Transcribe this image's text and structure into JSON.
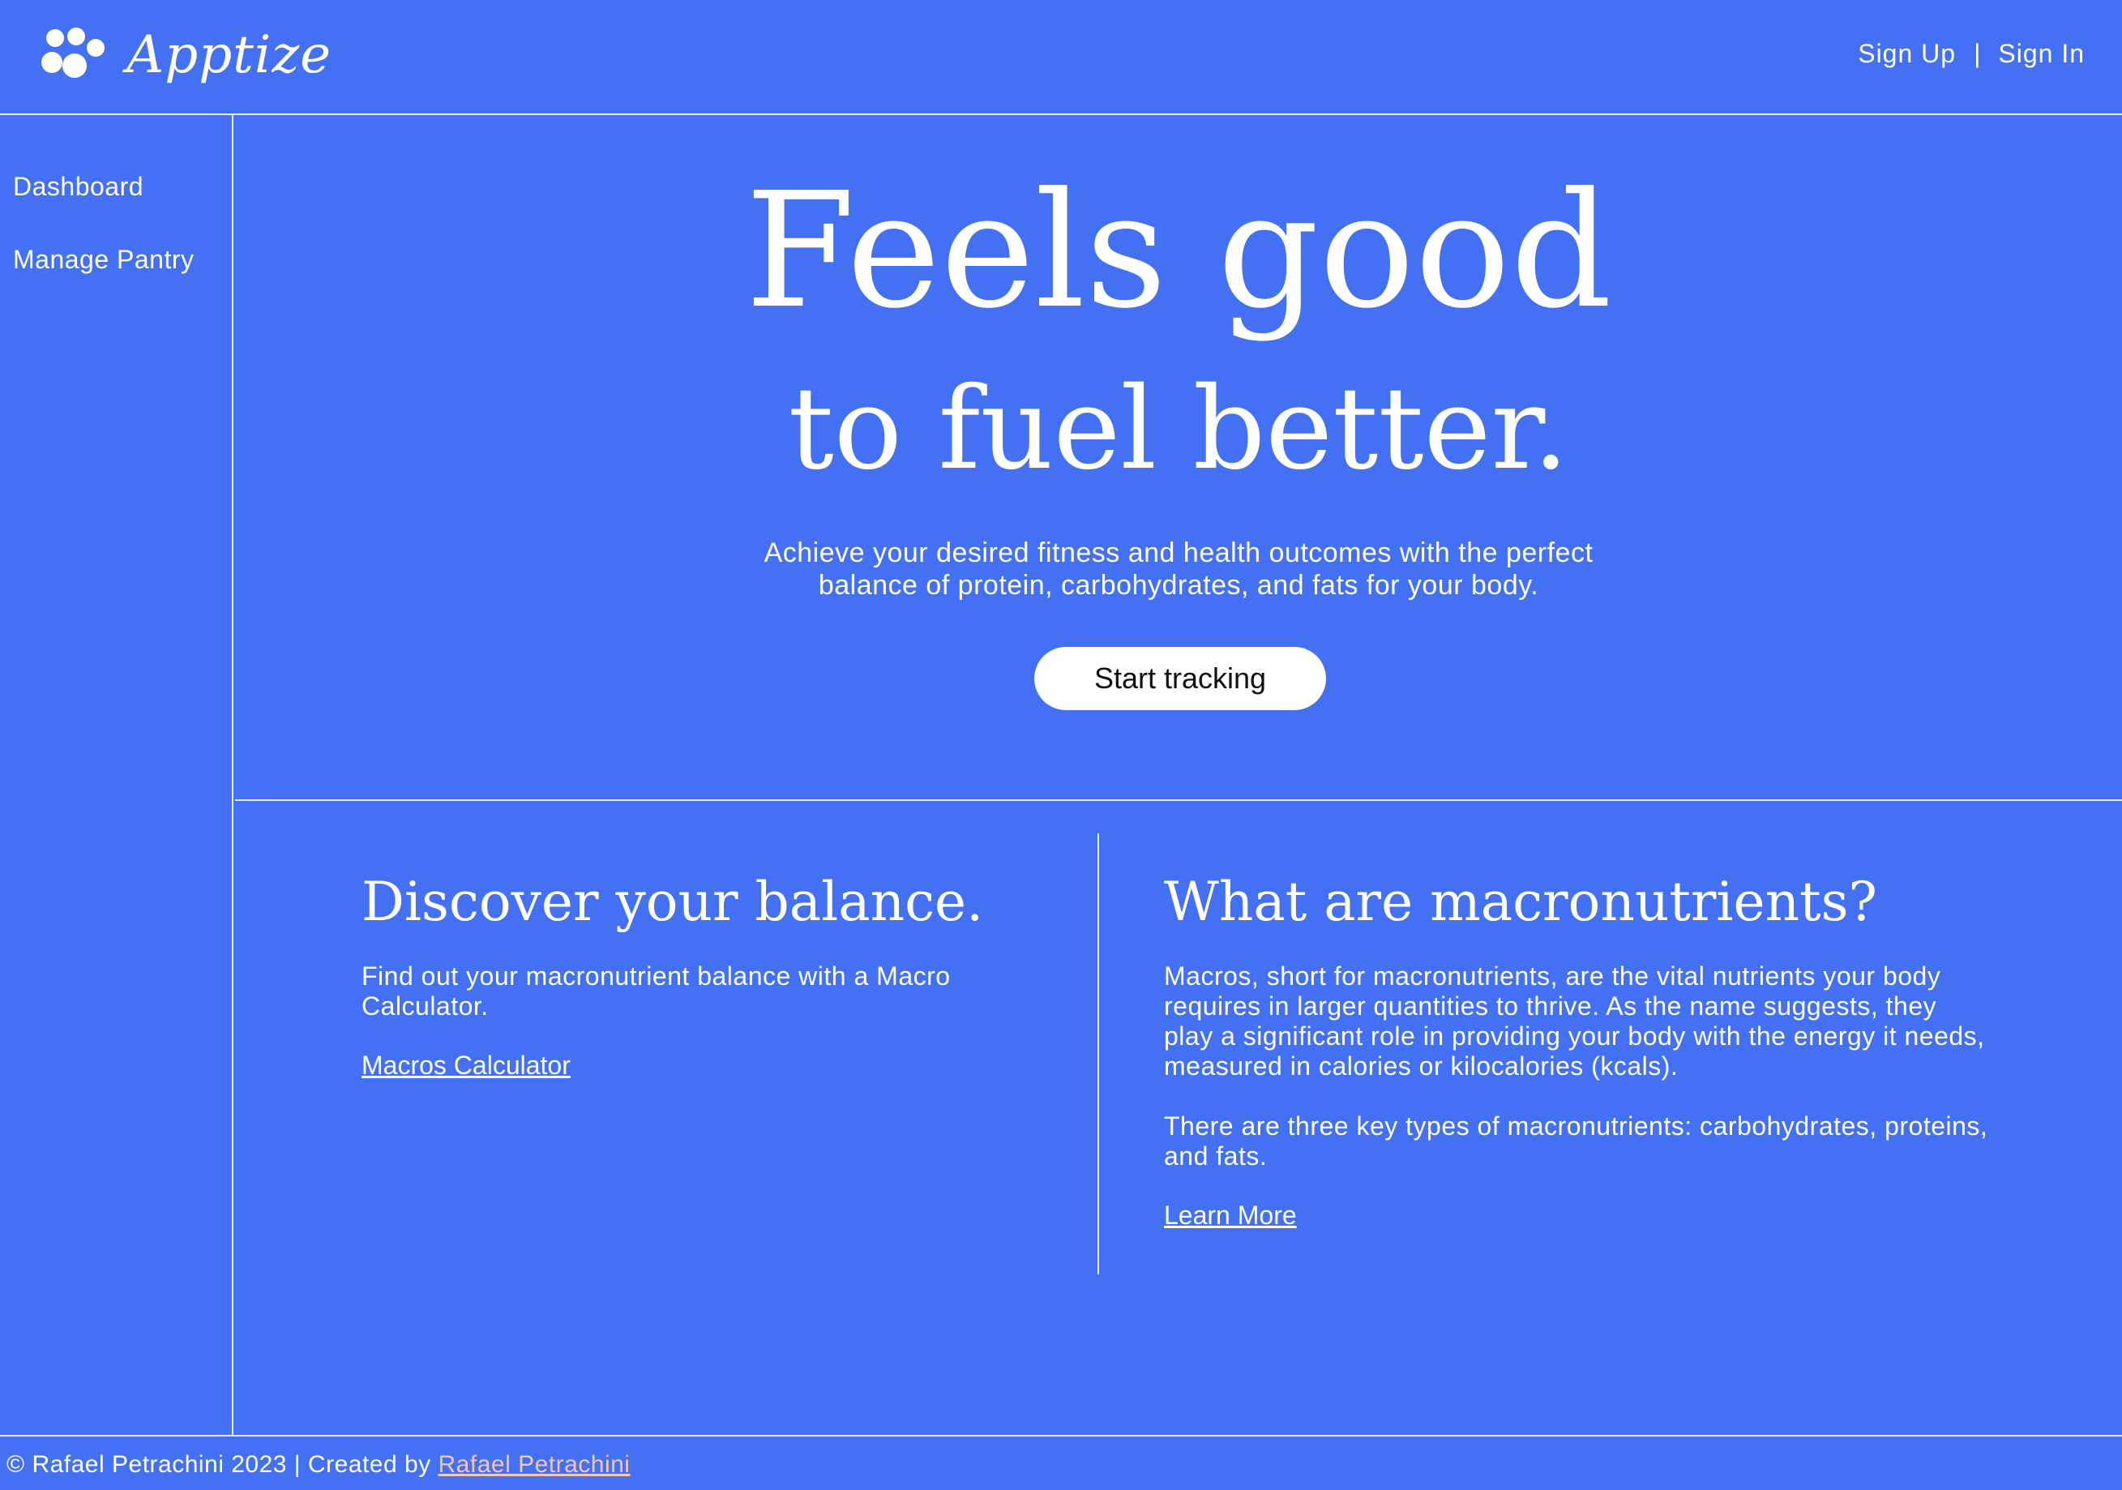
{
  "brand": {
    "name": "Apptize",
    "logo_icon": "paw-print-icon"
  },
  "header": {
    "sign_up": "Sign Up",
    "separator": "|",
    "sign_in": "Sign In"
  },
  "sidebar": {
    "items": [
      {
        "label": "Dashboard"
      },
      {
        "label": "Manage Pantry"
      }
    ]
  },
  "hero": {
    "title_line1": "Feels good",
    "title_line2": "to fuel better.",
    "subtitle": "Achieve your desired fitness and health outcomes with the perfect balance of protein, carbohydrates, and fats for your body.",
    "cta_label": "Start tracking"
  },
  "cards": [
    {
      "title": "Discover your balance.",
      "paragraphs": [
        "Find out your macronutrient balance with a Macro Calculator."
      ],
      "link_label": "Macros Calculator"
    },
    {
      "title": "What are macronutrients?",
      "paragraphs": [
        "Macros, short for macronutrients, are the vital nutrients your body requires in larger quantities to thrive. As the name suggests, they play a significant role in providing your body with the energy it needs, measured in calories or kilocalories (kcals).",
        "There are three key types of macronutrients: carbohydrates, proteins, and fats."
      ],
      "link_label": "Learn More"
    }
  ],
  "footer": {
    "copyright": "© Rafael Petrachini 2023 | Created by ",
    "author_link": "Rafael Petrachini"
  },
  "colors": {
    "background": "#4470f4",
    "text": "#ffffff",
    "footer_link": "#f6c6b0",
    "button_bg": "#ffffff",
    "button_text": "#111111"
  }
}
